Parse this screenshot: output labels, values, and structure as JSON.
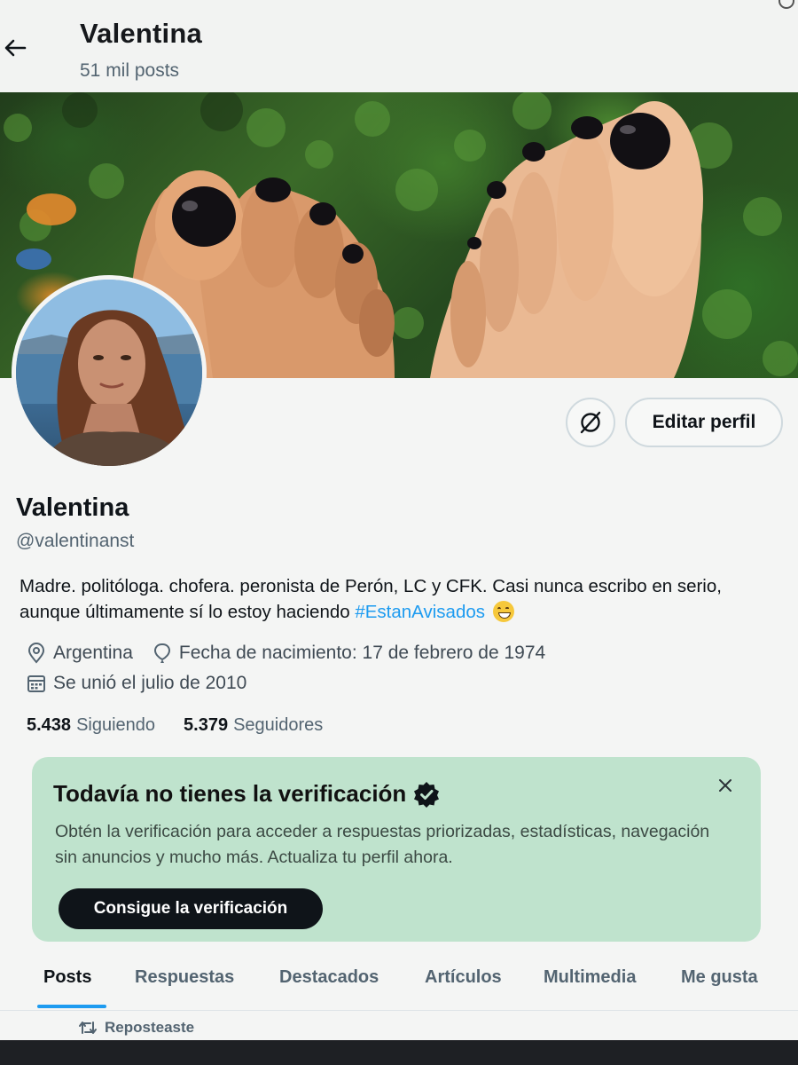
{
  "header": {
    "title": "Valentina",
    "posts_count": "51 mil posts"
  },
  "profile": {
    "name": "Valentina",
    "handle": "@valentinanst",
    "bio_text": "Madre. politóloga. chofera. peronista de Perón, LC y CFK. Casi nunca escribo en serio, aunque últimamente sí lo estoy haciendo ",
    "bio_hashtag": "#EstanAvisados",
    "location": "Argentina",
    "birthdate": "Fecha de nacimiento: 17 de febrero de 1974",
    "joined": "Se unió el julio de 2010",
    "following_count": "5.438",
    "following_label": "Siguiendo",
    "followers_count": "5.379",
    "followers_label": "Seguidores",
    "edit_button": "Editar perfil"
  },
  "verification": {
    "title": "Todavía no tienes la verificación",
    "description": "Obtén la verificación para acceder a respuestas priorizadas, estadísticas, navegación sin anuncios y mucho más. Actualiza tu perfil ahora.",
    "button": "Consigue la verificación"
  },
  "tabs": [
    {
      "label": "Posts",
      "active": true
    },
    {
      "label": "Respuestas",
      "active": false
    },
    {
      "label": "Destacados",
      "active": false
    },
    {
      "label": "Artículos",
      "active": false
    },
    {
      "label": "Multimedia",
      "active": false
    },
    {
      "label": "Me gusta",
      "active": false
    }
  ],
  "feed": {
    "repost_label": "Reposteaste"
  },
  "colors": {
    "accent": "#1d9bf0",
    "verification_bg": "#bfe3cd",
    "primary_button": "#0f1419"
  },
  "icons": {
    "back": "arrow-left-icon",
    "grok": "circle-slash-icon",
    "location": "location-pin-icon",
    "birthday": "balloon-icon",
    "calendar": "calendar-icon",
    "verified": "verified-badge-icon",
    "close": "close-icon",
    "repost": "repost-icon"
  }
}
